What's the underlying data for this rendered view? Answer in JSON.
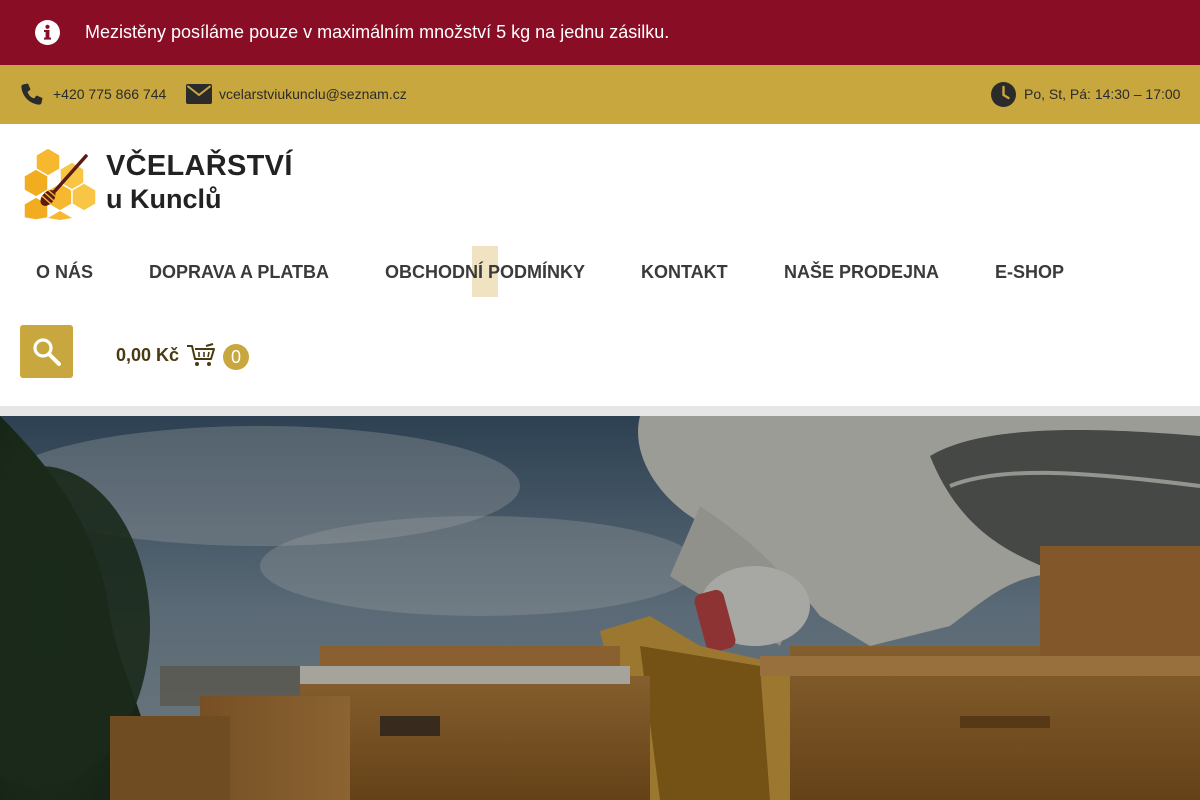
{
  "notice": {
    "text": "Mezistěny posíláme pouze v maximálním množství 5 kg na jednu zásilku.",
    "icon": "info-icon",
    "bg_color": "#8a0d26"
  },
  "topbar": {
    "phone": "+420 775 866 744",
    "email": "vcelarstviukunclu@seznam.cz",
    "hours": "Po, St, Pá: 14:30 – 17:00",
    "bg_color": "#c8a73f",
    "icons": [
      "phone-icon",
      "mail-icon",
      "clock-icon"
    ]
  },
  "logo": {
    "line1": "VČELAŘSTVÍ",
    "line2": "u Kunclů"
  },
  "nav": {
    "items": [
      {
        "label": "O NÁS"
      },
      {
        "label": "DOPRAVA A PLATBA"
      },
      {
        "label": "OBCHODNÍ PODMÍNKY"
      },
      {
        "label": "KONTAKT"
      },
      {
        "label": "NAŠE PRODEJNA"
      },
      {
        "label": "E-SHOP"
      }
    ]
  },
  "cart": {
    "price": "0,00 Kč",
    "count": "0",
    "icons": [
      "search-icon",
      "cart-icon"
    ]
  },
  "colors": {
    "accent": "#c8a73f",
    "brand_red": "#8a0d26",
    "nav_highlight": "#efe3c2"
  }
}
